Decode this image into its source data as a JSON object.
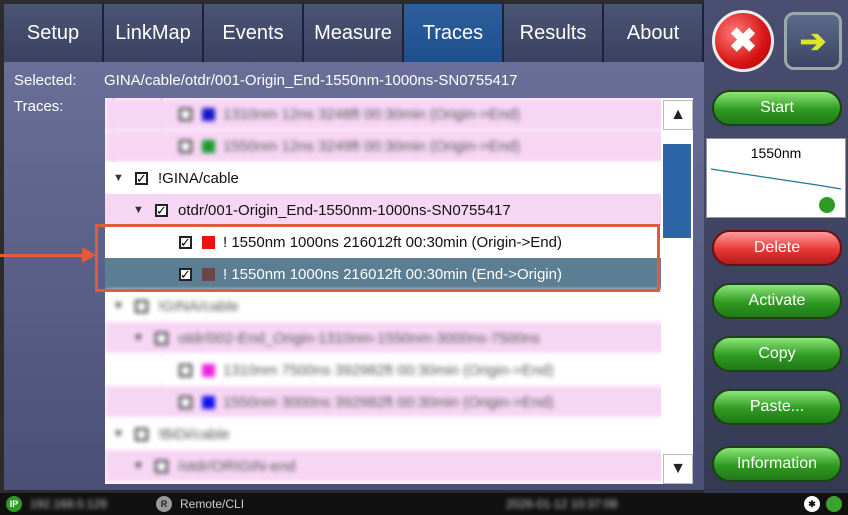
{
  "tabs": [
    "Setup",
    "LinkMap",
    "Events",
    "Measure",
    "Traces",
    "Results",
    "About"
  ],
  "active_tab": "Traces",
  "selected_label": "Selected:",
  "selected_value": "GINA/cable/otdr/001-Origin_End-1550nm-1000ns-SN0755417",
  "traces_label": "Traces:",
  "tree": [
    {
      "text": "1310nm 12ns 3248ft 00:30min (Origin->End)",
      "check": "",
      "swatch": "#1416c8",
      "blurred": true
    },
    {
      "text": "1550nm 12ns 3249ft 00:30min (Origin->End)",
      "check": "",
      "swatch": "#1a9a32",
      "blurred": true
    },
    {
      "text": "!GINA/cable",
      "check": "☑",
      "expander": "▼",
      "blurred": false
    },
    {
      "text": "otdr/001-Origin_End-1550nm-1000ns-SN0755417",
      "check": "☑",
      "expander": "▼",
      "blurred": false
    },
    {
      "text": "! 1550nm 1000ns 216012ft 00:30min (Origin->End)",
      "check": "☑",
      "swatch": "#ee1111",
      "blurred": false
    },
    {
      "text": "! 1550nm 1000ns 216012ft 00:30min (End->Origin)",
      "check": "☑",
      "swatch": "#6b4548",
      "blurred": false
    },
    {
      "text": "!GINA/cable",
      "check": "",
      "expander": "▼",
      "blurred": true
    },
    {
      "text": "otdr/002-End_Origin-1310nm-1550nm-3000ns-7500ns",
      "check": "",
      "expander": "▼",
      "blurred": true
    },
    {
      "text": "1310nm 7500ns 392982ft 00:30min (Origin->End)",
      "check": "",
      "swatch": "#ee22dd",
      "blurred": true
    },
    {
      "text": "1550nm 3000ns 392982ft 00:30min (Origin->End)",
      "check": "",
      "swatch": "#1111ee",
      "blurred": true
    },
    {
      "text": "!BiDi/cable",
      "check": "",
      "expander": "▼",
      "blurred": true
    },
    {
      "text": "/otdr/ORIGIN-end",
      "check": "",
      "expander": "▼",
      "blurred": true
    }
  ],
  "checkbox_mark": "✓",
  "scroll_up": "▲",
  "scroll_down": "▼",
  "side": {
    "close_icon": "✖",
    "next_icon": "➔",
    "start": "Start",
    "preview_label": "1550nm",
    "delete": "Delete",
    "activate": "Activate",
    "copy": "Copy",
    "paste": "Paste...",
    "information": "Information"
  },
  "status": {
    "ip_badge": "IP",
    "ip_value": "192.168.0.129",
    "remote_badge": "R",
    "remote_label": "Remote/CLI",
    "datetime": "2026-01-12 10:37:08",
    "bt_icon": "✱"
  }
}
